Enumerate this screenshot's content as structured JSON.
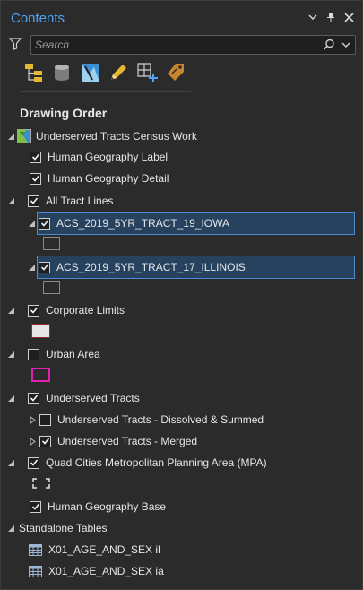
{
  "header": {
    "title": "Contents"
  },
  "search": {
    "placeholder": "Search"
  },
  "section": {
    "title": "Drawing Order"
  },
  "tree": {
    "map": "Underserved Tracts Census Work",
    "human_label": "Human Geography Label",
    "human_detail": "Human Geography Detail",
    "all_tract": "All Tract Lines",
    "iowa": "ACS_2019_5YR_TRACT_19_IOWA",
    "illinois": "ACS_2019_5YR_TRACT_17_ILLINOIS",
    "corporate": "Corporate Limits",
    "urban": "Urban Area",
    "underserved": "Underserved Tracts",
    "dissolved": "Underserved Tracts - Dissolved & Summed",
    "merged": "Underserved Tracts - Merged",
    "quad": "Quad Cities Metropolitan Planning Area (MPA)",
    "human_base": "Human Geography Base",
    "standalone": "Standalone Tables",
    "table_il": "X01_AGE_AND_SEX il",
    "table_ia": "X01_AGE_AND_SEX ia"
  },
  "colors": {
    "accent": "#4fa4ff",
    "selection": "#26425f",
    "corporate_outline": "#8b2a2a",
    "urban_outline": "#e020b0"
  }
}
